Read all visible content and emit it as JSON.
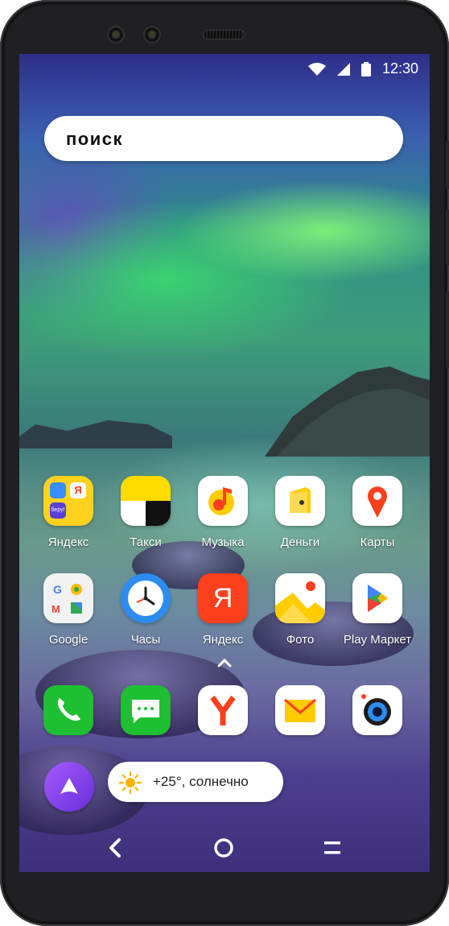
{
  "status_bar": {
    "time": "12:30",
    "icons": [
      "wifi-icon",
      "cellular-signal-icon",
      "battery-icon"
    ]
  },
  "search": {
    "label": "поиск"
  },
  "apps_row1": [
    {
      "label": "Яндекс",
      "icon": "yandex-folder-icon"
    },
    {
      "label": "Такси",
      "icon": "taxi-icon"
    },
    {
      "label": "Музыка",
      "icon": "music-icon"
    },
    {
      "label": "Деньги",
      "icon": "money-wallet-icon"
    },
    {
      "label": "Карты",
      "icon": "maps-pin-icon"
    }
  ],
  "apps_row2": [
    {
      "label": "Google",
      "icon": "google-folder-icon"
    },
    {
      "label": "Часы",
      "icon": "clock-icon"
    },
    {
      "label": "Яндекс",
      "icon": "yandex-browser-icon"
    },
    {
      "label": "Фото",
      "icon": "photo-icon"
    },
    {
      "label": "Play Маркет",
      "icon": "play-store-icon"
    }
  ],
  "dock": [
    {
      "name": "phone",
      "icon": "phone-icon"
    },
    {
      "name": "messages",
      "icon": "messages-icon"
    },
    {
      "name": "yandex-browser",
      "icon": "yandex-y-icon"
    },
    {
      "name": "mail",
      "icon": "mail-icon"
    },
    {
      "name": "camera",
      "icon": "camera-icon"
    }
  ],
  "weather": {
    "text": "+25°, солнечно",
    "icon": "sun-icon"
  },
  "folder_labels": {
    "beru": "беру!"
  },
  "yandex_letter": "Я",
  "navigation": [
    "back-icon",
    "home-icon",
    "menu-icon"
  ],
  "colors": {
    "taxi_yellow": "#ffdb00",
    "yandex_red": "#fc3f1d",
    "phone_green": "#1fbf33",
    "alice_purple": "#8a45ec"
  }
}
